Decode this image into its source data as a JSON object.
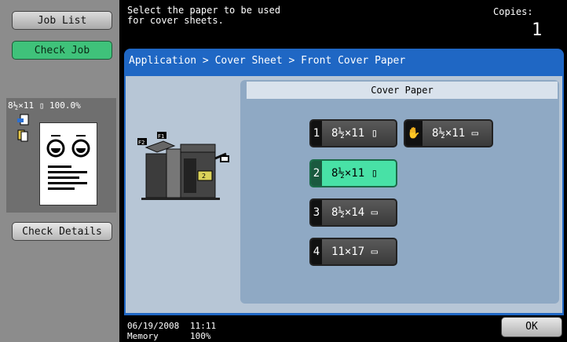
{
  "left": {
    "job_list": "Job List",
    "check_job": "Check Job",
    "preview_header": "8½×11 ▯  100.0%",
    "check_details": "Check Details"
  },
  "top": {
    "message": "Select the paper to be used\nfor cover sheets.",
    "copies_label": "Copies:",
    "copies_value": "1"
  },
  "breadcrumb": "Application > Cover Sheet > Front Cover Paper",
  "section_title": "Cover Paper",
  "options": [
    {
      "num": "1",
      "label": "8½×11 ▯"
    },
    {
      "num": "",
      "label": "8½×11 ▭",
      "icon": "bypass-hand-icon"
    },
    {
      "num": "2",
      "label": "8½×11 ▯",
      "selected": true
    },
    {
      "num": "3",
      "label": "8½×14 ▭"
    },
    {
      "num": "4",
      "label": "11×17 ▭"
    }
  ],
  "status": {
    "date": "06/19/2008",
    "time": "11:11",
    "memory_label": "Memory",
    "memory_value": "100%"
  },
  "ok_label": "OK",
  "colors": {
    "selected": "#48e1a6",
    "accent": "#1f67c4",
    "check_job": "#3fc27a"
  },
  "machine_labels": {
    "tray1": "F1",
    "tray2": "F2",
    "tray_num": "2"
  }
}
